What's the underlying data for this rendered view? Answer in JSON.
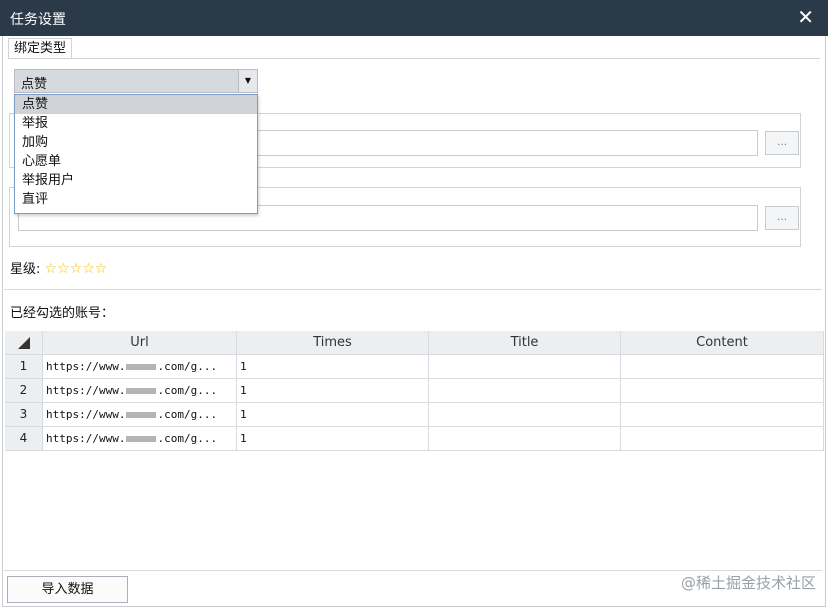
{
  "window": {
    "title": "任务设置",
    "close_glyph": "✕"
  },
  "bind_type": {
    "tab_label": "绑定类型",
    "selected": "点赞",
    "options": [
      "点赞",
      "举报",
      "加购",
      "心愿单",
      "举报用户",
      "直评"
    ]
  },
  "fields": {
    "browse_label": "…"
  },
  "rating": {
    "label": "星级:",
    "stars": 5,
    "max": 5
  },
  "accounts": {
    "label": "已经勾选的账号：",
    "columns": [
      "Url",
      "Times",
      "Title",
      "Content"
    ],
    "rows": [
      {
        "n": "1",
        "url_prefix": "https://www.",
        "url_suffix": ".com/g...",
        "times": "1",
        "title": "",
        "content": ""
      },
      {
        "n": "2",
        "url_prefix": "https://www.",
        "url_suffix": ".com/g...",
        "times": "1",
        "title": "",
        "content": ""
      },
      {
        "n": "3",
        "url_prefix": "https://www.",
        "url_suffix": ".com/g...",
        "times": "1",
        "title": "",
        "content": ""
      },
      {
        "n": "4",
        "url_prefix": "https://www.",
        "url_suffix": ".com/g...",
        "times": "1",
        "title": "",
        "content": ""
      }
    ]
  },
  "footer": {
    "import_label": "导入数据",
    "watermark": "@稀土掘金技术社区"
  },
  "colors": {
    "titlebar": "#2b3a48",
    "star": "#f2c200",
    "dropdown_border": "#7d9cc9"
  }
}
